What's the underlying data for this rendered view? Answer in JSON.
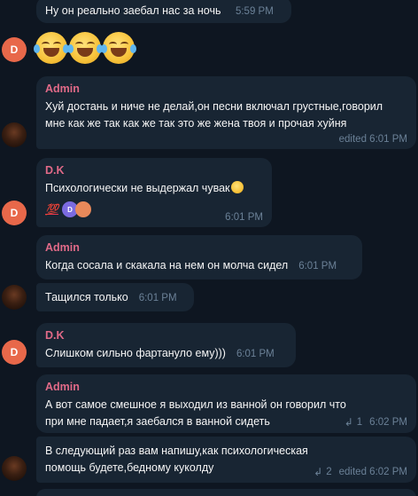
{
  "messages": [
    {
      "id": "m1",
      "text": "Ну он реально заебал нас за ночь",
      "time": "5:59 PM"
    },
    {
      "id": "m2",
      "emoji_count": 3,
      "emoji": "face-with-tears-of-joy-icon"
    },
    {
      "id": "m3",
      "sender": "Admin",
      "text": "Хуй достань и ниче не делай,он песни включал грустные,говорил мне как же так как же так это же жена твоя и прочая хуйня",
      "time": "edited 6:01 PM"
    },
    {
      "id": "m4",
      "sender": "D.K",
      "text": "Психологически не выдержал чувак",
      "time": "6:01 PM",
      "reactions": {
        "emoji": "💯",
        "avatars": [
          "D",
          ""
        ]
      }
    },
    {
      "id": "m5",
      "sender": "Admin",
      "text": "Когда сосала  и скакала на нем он молча сидел",
      "time": "6:01 PM"
    },
    {
      "id": "m6",
      "text": "Тащился только",
      "time": "6:01 PM"
    },
    {
      "id": "m7",
      "sender": "D.K",
      "text": "Слишком сильно фартануло ему)))",
      "time": "6:01 PM"
    },
    {
      "id": "m8",
      "sender": "Admin",
      "text": "А вот самое смешное я выходил из ванной он говорил что при мне падает,я заебался в ванной сидеть",
      "time": "6:02 PM",
      "replies": "1"
    },
    {
      "id": "m9",
      "text": "В следующий раз вам напишу,как психологическая помощь будете,бедному куколду",
      "time": "edited 6:02 PM",
      "replies": "2"
    }
  ],
  "avatars": {
    "dk_letter": "D"
  },
  "colors": {
    "background": "#0e1621",
    "bubble": "#182533",
    "sender_name": "#e16a88",
    "meta": "#6b8197",
    "avatar_dk": "#e8684a"
  }
}
